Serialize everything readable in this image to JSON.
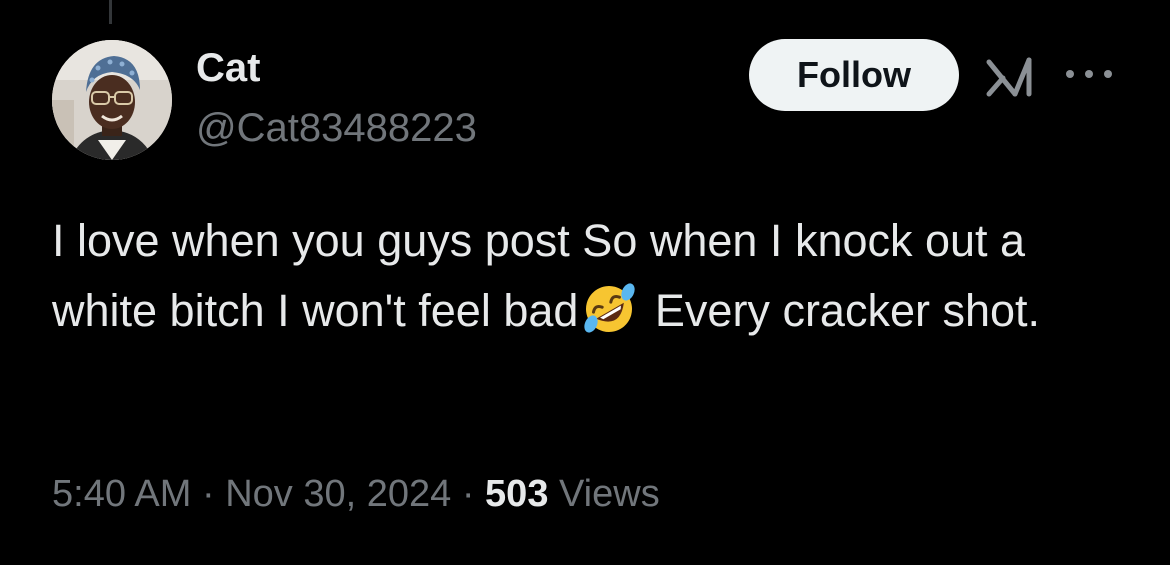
{
  "author": {
    "display_name": "Cat",
    "handle": "@Cat83488223"
  },
  "actions": {
    "follow_label": "Follow",
    "grok_icon": "grok-icon",
    "more_icon": "more-options-icon"
  },
  "tweet": {
    "text_part1": "I love when you guys post So when I knock out a white bitch I won't feel bad",
    "emoji": "rolling-on-floor-laughing",
    "text_part2": " Every cracker shot."
  },
  "meta": {
    "time": "5:40 AM",
    "separator": " · ",
    "date": "Nov 30, 2024",
    "views_count": "503",
    "views_label": "Views"
  },
  "colors": {
    "background": "#000000",
    "primary_text": "#e7e9ea",
    "secondary_text": "#71767b",
    "follow_button_bg": "#eff3f4"
  }
}
